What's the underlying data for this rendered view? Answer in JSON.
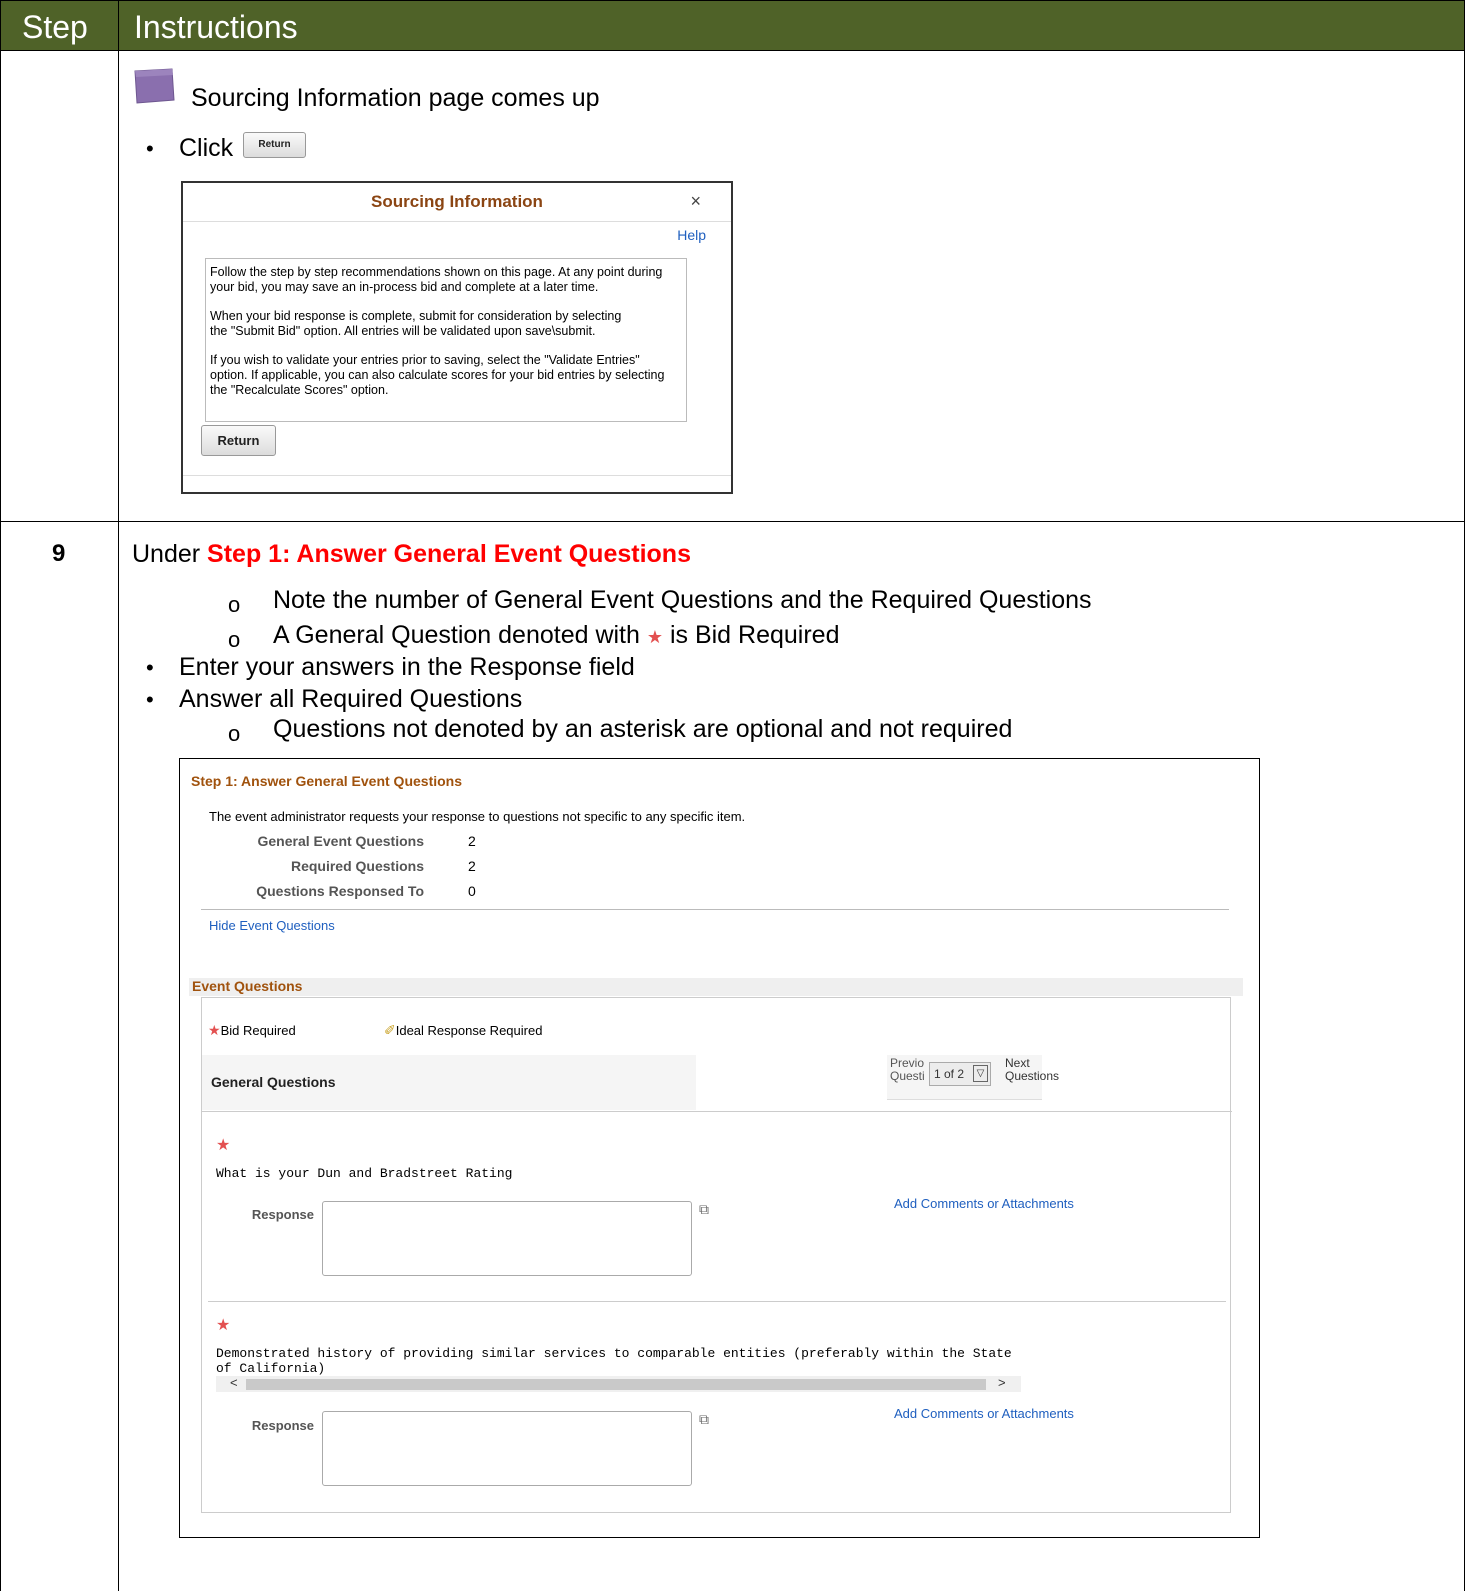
{
  "table": {
    "col_step": "Step",
    "col_instructions": "Instructions"
  },
  "row1": {
    "caption": "Sourcing Information page comes up",
    "click_text": "Click",
    "return_small": "Return",
    "dialog": {
      "title": "Sourcing Information",
      "close": "×",
      "help": "Help",
      "para1": "Follow the step by step recommendations shown on this page.  At any point during\nyour bid, you may save an in-process bid and complete at a later time.",
      "para2": "When your bid response is complete, submit for consideration by selecting\nthe \"Submit Bid\" option.  All entries will be validated upon save\\submit.",
      "para3": "If you wish to validate your entries prior to saving, select the \"Validate Entries\"\noption.  If applicable, you can also calculate scores for your bid entries by selecting\nthe \"Recalculate Scores\" option.",
      "return_button": "Return"
    }
  },
  "row2": {
    "step_number": "9",
    "under_text": "Under ",
    "under_highlight": "Step 1: Answer General Event Questions",
    "sub1": "Note the number of General Event Questions and the Required Questions",
    "sub2a": "A General Question denoted with ",
    "sub2b": " is Bid Required",
    "bullet1": "Enter your answers in the Response field",
    "bullet2": "Answer all Required Questions",
    "sub3": "Questions not denoted by an asterisk are optional and not required"
  },
  "panel": {
    "title": "Step 1: Answer General Event Questions",
    "intro": "The event administrator requests your response to questions not specific to any specific item.",
    "stats": [
      {
        "label": "General Event Questions",
        "value": "2"
      },
      {
        "label": "Required Questions",
        "value": "2"
      },
      {
        "label": "Questions Responsed To",
        "value": "0"
      }
    ],
    "hide_link": "Hide Event Questions",
    "event_questions": "Event Questions",
    "legend_bid": "Bid Required",
    "legend_ideal": "Ideal Response Required",
    "general_questions": "General Questions",
    "prev_label_1": "Previo",
    "prev_label_2": "Questi",
    "pager": "1 of 2",
    "next_label_1": "Next",
    "next_label_2": "Questions",
    "q1": "What is your Dun and Bradstreet Rating",
    "q2_line1": "Demonstrated history of providing similar services to comparable entities (preferably within the State",
    "q2_line2": "of California)",
    "response_label": "Response",
    "add_comments": "Add Comments or Attachments"
  }
}
